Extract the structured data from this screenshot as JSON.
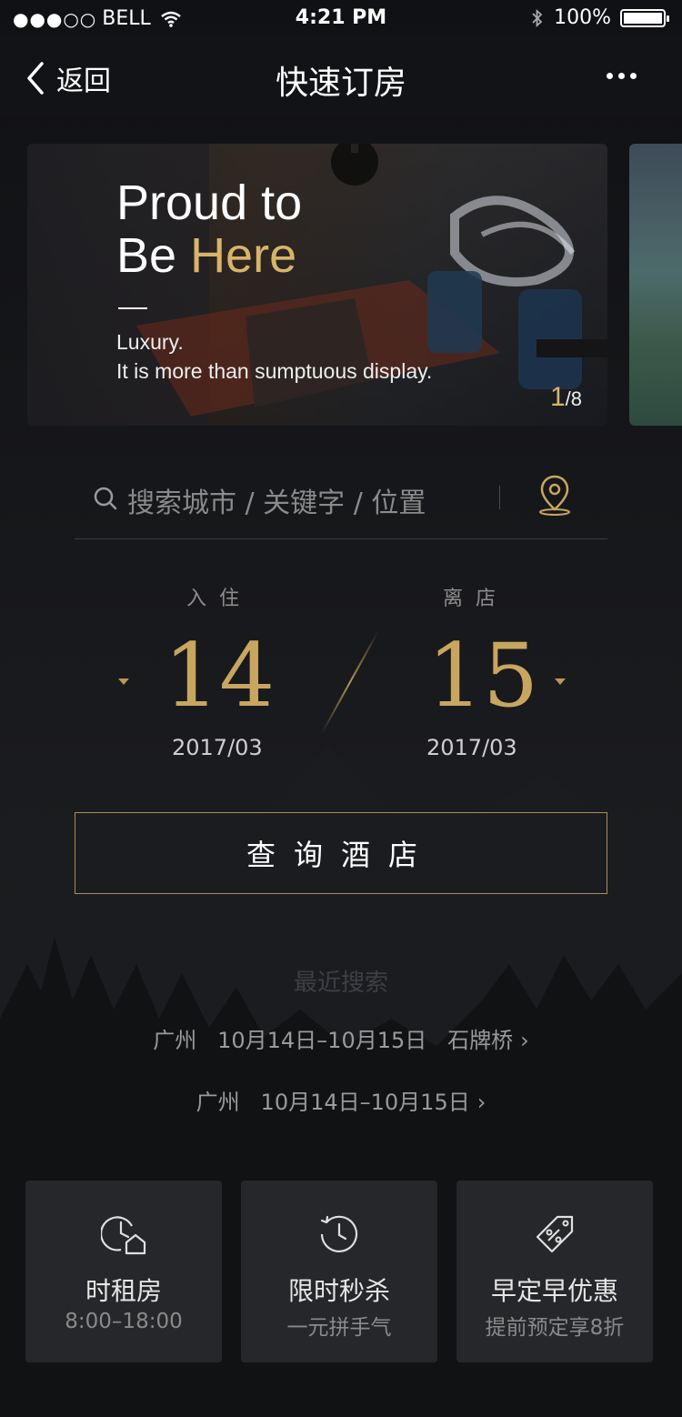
{
  "status_bar": {
    "signal": "●●●○○",
    "carrier": "BELL",
    "time": "4:21 PM",
    "battery": "100%",
    "battery_level": 1.0
  },
  "nav": {
    "back_label": "返回",
    "title": "快速订房"
  },
  "banner": {
    "headline_line1": "Proud to",
    "headline_line2_a": "Be ",
    "headline_line2_b": "Here",
    "sub_line1": "Luxury.",
    "sub_line2": "It is more than sumptuous display.",
    "page_current": "1",
    "page_total": "/8"
  },
  "search": {
    "placeholder": "搜索城市 / 关键字 / 位置"
  },
  "dates": {
    "checkin_label": "入住",
    "checkin_day": "14",
    "checkin_month": "2017/03",
    "checkout_label": "离店",
    "checkout_day": "15",
    "checkout_month": "2017/03"
  },
  "query_button": "查询酒店",
  "recent": {
    "title": "最近搜索",
    "items": [
      "广州   10月14日–10月15日   石牌桥",
      "广州   10月14日–10月15日"
    ]
  },
  "cards": [
    {
      "title": "时租房",
      "subtitle": "8:00–18:00",
      "icon": "clock-home-icon"
    },
    {
      "title": "限时秒杀",
      "subtitle": "一元拼手气",
      "icon": "timer-icon"
    },
    {
      "title": "早定早优惠",
      "subtitle": "提前预定享8折",
      "icon": "discount-tag-icon"
    }
  ],
  "colors": {
    "gold": "#c8a660",
    "background": "#141518"
  }
}
